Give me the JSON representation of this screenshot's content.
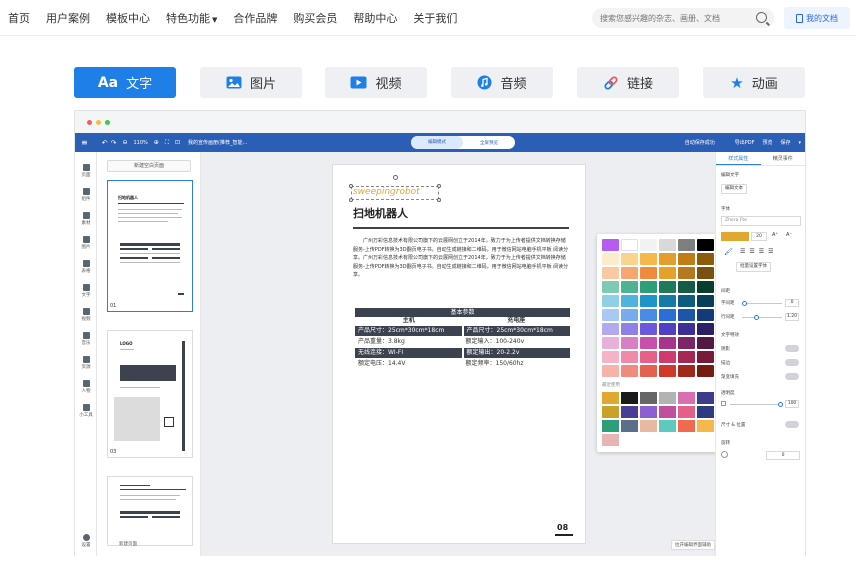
{
  "nav": {
    "items": [
      "首页",
      "用户案例",
      "模板中心",
      "特色功能",
      "合作品牌",
      "购买会员",
      "帮助中心",
      "关于我们"
    ],
    "dropdown_item": 3
  },
  "search": {
    "placeholder": "搜索您感兴趣的杂志、画册、文档"
  },
  "my_docs": "我的文档",
  "content_tabs": [
    {
      "label": "文字",
      "icon_text": "Aa"
    },
    {
      "label": "图片"
    },
    {
      "label": "视频"
    },
    {
      "label": "音频"
    },
    {
      "label": "链接"
    },
    {
      "label": "动画"
    }
  ],
  "colors": {
    "accent": "#1f7fe8",
    "toolbar": "#2a5fb5",
    "dark_block": "#3c4250",
    "brand_gold": "#e0a82e"
  },
  "editor": {
    "zoom": "110%",
    "doc_title": "我的宣传画册(推荐_智能...",
    "mode_edit": "编辑模式",
    "mode_preview": "全屏预览",
    "autosave": "自动保存成功",
    "right_buttons": [
      "导出PDF",
      "预览",
      "保存"
    ],
    "left_rail": [
      "页面",
      "组件",
      "素材",
      "图片",
      "表格",
      "文字",
      "视频",
      "音乐",
      "资源",
      "人物",
      "小工具"
    ],
    "left_rail_bottom": "设置",
    "add_page": "新建空白页面",
    "add_page_bottom": "新建页面",
    "thumb_pages": [
      "01",
      "03"
    ],
    "thumb3_title": "LOGO",
    "canvas": {
      "brand": "sweepingrobot",
      "title": "扫地机器人",
      "body": "广州万彩信息技术有限公司旗下的云展网创立于2014年，致力于为上传者提供文档转换存储服务-上传PDF转换为3D翻页电子书，自动生成链接和二维码，用于微信网站电脑手机平板 阅读分享。广州万彩信息技术有限公司旗下的云展网创立于2014年，致力于为上传者提供文档转换存储服务-上传PDF转换为3D翻页电子书。自动生成链接和二维码，用于微信网站电脑手机平板 阅读分享。",
      "table_title": "基本参数",
      "table_heads": [
        "主机",
        "充电座"
      ],
      "table_rows": [
        [
          "产品尺寸：25cm*30cm*18cm",
          "产品尺寸：25cm*30cm*18cm"
        ],
        [
          "产品重量：3.8kg",
          "额定输入：100-240v"
        ],
        [
          "无线连接：WI-FI",
          "额定输出：20-2.2v"
        ],
        [
          "额定电压：14.4V",
          "额定频率：150/60hz"
        ]
      ],
      "page_number": "08"
    },
    "palette": {
      "recent_label": "最近使用",
      "colors": [
        "#b65cf0",
        "#ffffff",
        "#f2f2f2",
        "#d9d9d9",
        "#7f7f7f",
        "#000000",
        "#fdeccb",
        "#fbd38d",
        "#f7b84b",
        "#e59e2e",
        "#c27c14",
        "#8f5a0a",
        "#f8c9a3",
        "#f6a670",
        "#f08a3e",
        "#e5a12a",
        "#b7791f",
        "#7a4f12",
        "#7fcab2",
        "#4fb393",
        "#2e9e7a",
        "#1f7a5c",
        "#145c44",
        "#0a3d2d",
        "#8fd0e8",
        "#4fb3dc",
        "#1f94c8",
        "#157aa8",
        "#0e5c80",
        "#083e58",
        "#a9c8f4",
        "#7aaaee",
        "#4a8be6",
        "#2a6fd6",
        "#1f55a8",
        "#143b78",
        "#b3a9f0",
        "#8f80e8",
        "#6b58dd",
        "#5240c4",
        "#3d2f96",
        "#2a2068",
        "#e8b0dc",
        "#d97fc6",
        "#c94fae",
        "#a7358d",
        "#7d2569",
        "#541846",
        "#f5b3c7",
        "#ef8aa9",
        "#e6608a",
        "#d13a6c",
        "#a52853",
        "#781b3b",
        "#f6b3a9",
        "#ef8a7c",
        "#e5604f",
        "#cf3a2a",
        "#a3281c",
        "#741b12"
      ],
      "recent": [
        "#e0a82e",
        "#1a1a1a",
        "#666666",
        "#b3b3b3",
        "#d96fae",
        "#3c3c8a",
        "#c9a227",
        "#4a3d96",
        "#8e5fd0",
        "#c04fa0",
        "#e3608a",
        "#2f3b80",
        "#2e9e7a",
        "#5c6f8a",
        "#e8b9a0",
        "#5dc9c0",
        "#f06a50",
        "#f5b84b",
        "#e8b5b5"
      ]
    },
    "side_panel": {
      "tabs": [
        "样式属性",
        "精灵事件"
      ],
      "edit_text_label": "编辑文字",
      "edit_text_button": "编辑文本",
      "font_label": "字体",
      "font_value": "Zhora Fte",
      "font_size": "20",
      "batch_font_button": "批量设置字体",
      "spacing_label": "间距",
      "char_spacing_label": "字间距",
      "char_spacing_value": "0",
      "line_spacing_label": "行间距",
      "line_spacing_value": "1.20",
      "text_effects_label": "文字特效",
      "shadow_label": "阴影",
      "stroke_label": "描边",
      "gradient_label": "渐变填充",
      "opacity_label": "透明度",
      "opacity_value": "100",
      "size_lock_label": "尺寸 & 位置",
      "rotate_label": "旋转",
      "rotate_value": "0"
    },
    "bottom_hint": "拉开编辑界面辅助"
  }
}
